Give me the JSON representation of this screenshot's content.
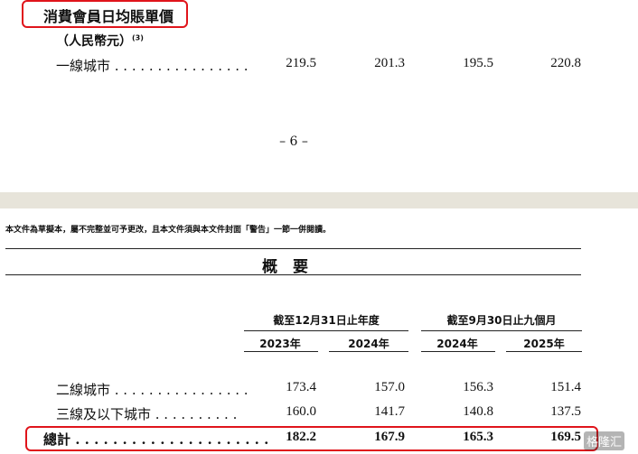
{
  "page1": {
    "section_title": "消費會員日均賬單價",
    "unit_label": "（人民幣元）",
    "unit_note": "(3)",
    "row": {
      "label": "一線城市 . . . . . . . . . . . . . . . .",
      "values": [
        "219.5",
        "201.3",
        "195.5",
        "220.8"
      ]
    },
    "page_number": "– 6 –"
  },
  "page2": {
    "disclaimer": "本文件為草擬本，屬不完整並可予更改，且本文件須與本文件封面「警告」一節一併閱讀。",
    "heading": "概　要",
    "group_headers": [
      "截至12月31日止年度",
      "截至9月30日止九個月"
    ],
    "years": [
      "2023年",
      "2024年",
      "2024年",
      "2025年"
    ],
    "rows": [
      {
        "label": "二線城市 . . . . . . . . . . . . . . . .",
        "values": [
          "173.4",
          "157.0",
          "156.3",
          "151.4"
        ]
      },
      {
        "label": "三線及以下城市 . . . . . . . . . .",
        "values": [
          "160.0",
          "141.7",
          "140.8",
          "137.5"
        ]
      },
      {
        "label": "總計 . . . . . . . . . . . . . . . . . . . . .",
        "values": [
          "182.2",
          "167.9",
          "165.3",
          "169.5"
        ],
        "bold": true
      }
    ],
    "watermark": "格隆汇"
  },
  "colors": {
    "highlight": "#e0141b",
    "gutter": "#e7e4da"
  }
}
